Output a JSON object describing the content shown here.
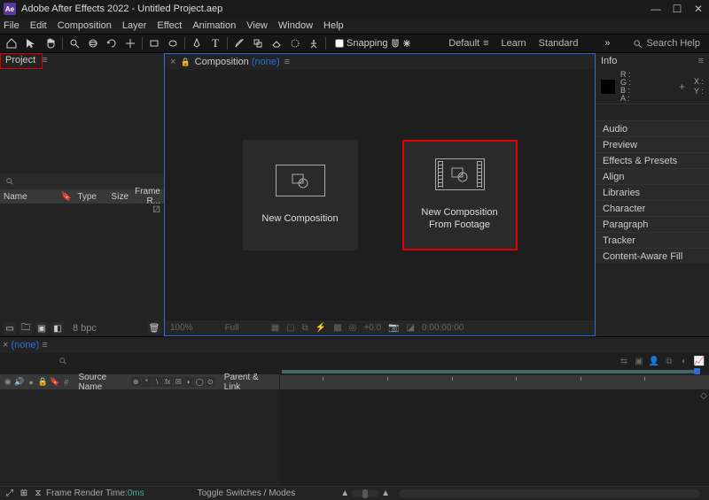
{
  "title": "Adobe After Effects 2022 - Untitled Project.aep",
  "logo": "Ae",
  "winctrl": {
    "min": "—",
    "max": "☐",
    "close": "✕"
  },
  "menu": [
    "File",
    "Edit",
    "Composition",
    "Layer",
    "Effect",
    "Animation",
    "View",
    "Window",
    "Help"
  ],
  "toolbar": {
    "snapping_label": "Snapping",
    "workspaces": [
      "Default",
      "Learn",
      "Standard"
    ],
    "chev": "»",
    "search_placeholder": "Search Help"
  },
  "project": {
    "tab_label": "Project",
    "columns": {
      "name": "Name",
      "type": "Type",
      "size": "Size",
      "framer": "Frame R..."
    },
    "flow_icon": "⚂",
    "footer": {
      "bpc": "8 bpc"
    }
  },
  "composition": {
    "tab_label": "Composition",
    "none_label": "(none)",
    "new_comp": "New Composition",
    "new_comp_footage1": "New Composition",
    "new_comp_footage2": "From Footage",
    "footer": {
      "pct": "100%",
      "res": "Full",
      "tc": "0:00:00:00",
      "val": "+0.0"
    }
  },
  "info": {
    "tab_label": "Info",
    "rgb": [
      "R :",
      "G :",
      "B :",
      "A :"
    ],
    "xy": [
      "X :",
      "Y :"
    ]
  },
  "right_panels": [
    "Audio",
    "Preview",
    "Effects & Presets",
    "Align",
    "Libraries",
    "Character",
    "Paragraph",
    "Tracker",
    "Content-Aware Fill"
  ],
  "timeline": {
    "none_label": "(none)",
    "col_source": "Source Name",
    "col_parent": "Parent & Link",
    "frame_render": "Frame Render Time:",
    "frame_render_val": "0ms",
    "toggle_label": "Toggle Switches / Modes",
    "switch_glyphs": [
      "⊕",
      "*",
      "\\",
      "fx",
      "☒",
      "◐",
      "◯",
      "⊙"
    ]
  }
}
